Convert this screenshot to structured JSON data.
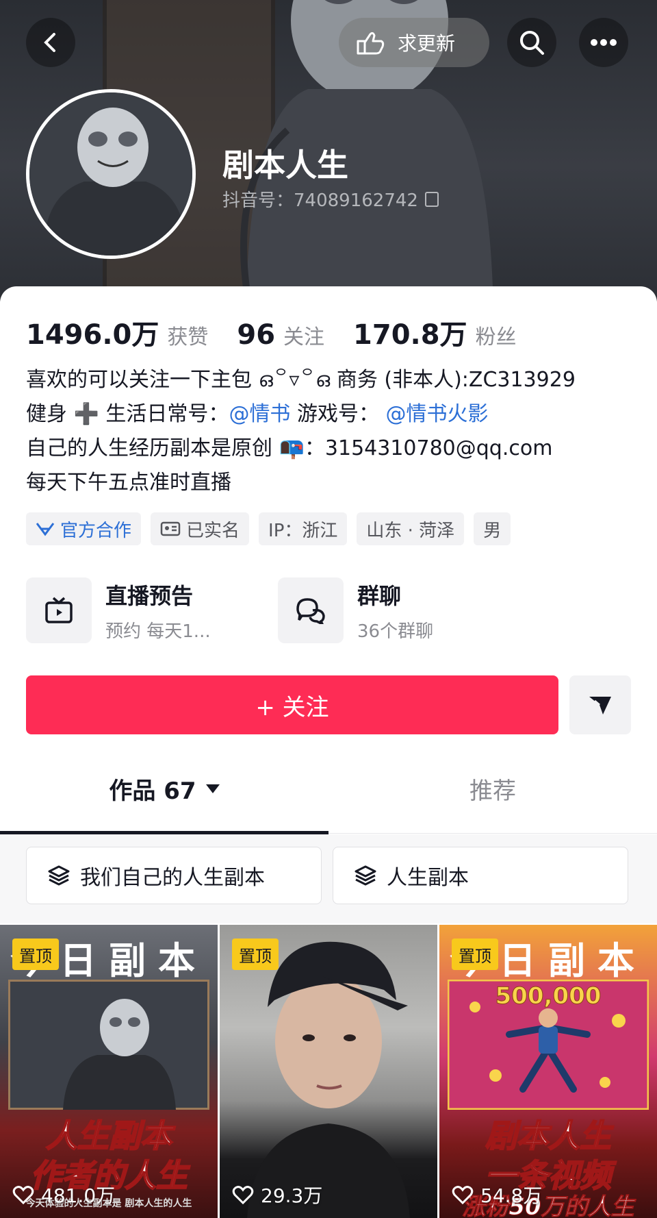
{
  "header": {
    "request_update_label": "求更新",
    "name": "剧本人生",
    "douyin_id": "抖音号：74089162742"
  },
  "stats": [
    {
      "value": "1496.0万",
      "label": "获赞"
    },
    {
      "value": "96",
      "label": "关注"
    },
    {
      "value": "170.8万",
      "label": "粉丝"
    }
  ],
  "bio": {
    "line1": "喜欢的可以关注一下主包 ഒ꒪▿꒪ഒ 商务 (非本人):ZC313929",
    "line2_prefix": "健身 ➕ 生活日常号：",
    "line2_link1": "@情书",
    "line2_mid": " 游戏号：",
    "line2_link2": "@情书火影",
    "line3": "自己的人生经历副本是原创 📭：3154310780@qq.com",
    "line4": "每天下午五点准时直播"
  },
  "tags": [
    "官方合作",
    "已实名",
    "IP：浙江",
    "山东 · 菏泽",
    "男"
  ],
  "features": [
    {
      "title": "直播预告",
      "subtitle": "预约 每天1..."
    },
    {
      "title": "群聊",
      "subtitle": "36个群聊"
    }
  ],
  "follow_label": "+ 关注",
  "tabs": {
    "works_label": "作品 67",
    "recommend_label": "推荐"
  },
  "collections": [
    "我们自己的人生副本",
    "人生副本"
  ],
  "videos": [
    {
      "pinned": "置顶",
      "likes": "481.0万",
      "header": "今日副本",
      "caption1": "人生副本",
      "caption2": "作者的人生",
      "footer": "今天体验的人生副本是 剧本人生的人生"
    },
    {
      "pinned": "置顶",
      "likes": "29.3万"
    },
    {
      "pinned": "置顶",
      "likes": "54.8万",
      "header": "今日副本",
      "badge": "500,000",
      "caption1": "剧本人生",
      "caption2": "一条视频",
      "caption3": "涨粉50万的人生"
    }
  ],
  "colors": {
    "accent": "#fe2c55",
    "link": "#2c6fd6",
    "pin": "#f8c91c"
  }
}
